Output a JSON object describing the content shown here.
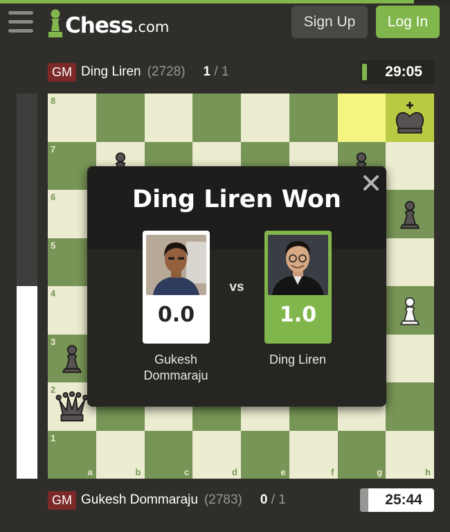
{
  "header": {
    "logo_text": "Chess",
    "logo_domain": ".com",
    "signup_label": "Sign Up",
    "login_label": "Log In"
  },
  "top_player": {
    "title": "GM",
    "name": "Ding Liren",
    "rating": "(2728)",
    "score": "1",
    "score_total": "/ 1",
    "clock": "29:05"
  },
  "bottom_player": {
    "title": "GM",
    "name": "Gukesh Dommaraju",
    "rating": "(2783)",
    "score": "0",
    "score_total": "/ 1",
    "clock": "25:44"
  },
  "eval_bar": {
    "white_fraction": 0.5
  },
  "board": {
    "ranks": [
      "8",
      "7",
      "6",
      "5",
      "4",
      "3",
      "2",
      "1"
    ],
    "files": [
      "a",
      "b",
      "c",
      "d",
      "e",
      "f",
      "g",
      "h"
    ],
    "highlighted_squares": [
      "g8",
      "h8"
    ],
    "pieces": [
      {
        "square": "h8",
        "piece": "king",
        "color": "black"
      },
      {
        "square": "b7",
        "piece": "pawn",
        "color": "black"
      },
      {
        "square": "g7",
        "piece": "pawn",
        "color": "black"
      },
      {
        "square": "h6",
        "piece": "pawn",
        "color": "black"
      },
      {
        "square": "h4",
        "piece": "pawn",
        "color": "white"
      },
      {
        "square": "a3",
        "piece": "pawn",
        "color": "black"
      },
      {
        "square": "a2",
        "piece": "queen",
        "color": "black"
      }
    ]
  },
  "result_modal": {
    "title": "Ding Liren Won",
    "vs_label": "vs",
    "left_player": {
      "name_line1": "Gukesh",
      "name_line2": "Dommaraju",
      "result": "0.0"
    },
    "right_player": {
      "name_line1": "Ding Liren",
      "name_line2": "",
      "result": "1.0"
    }
  },
  "colors": {
    "background": "#302e2b",
    "accent_green": "#81b64c",
    "light_square": "#ebecd0",
    "dark_square": "#779556",
    "highlight_light": "#f5f682",
    "highlight_dark": "#b9ca43",
    "gm_badge": "#7c2929"
  }
}
